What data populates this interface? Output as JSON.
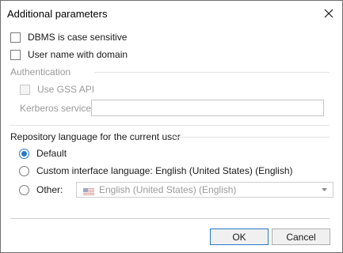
{
  "dialog": {
    "title": "Additional parameters",
    "close_icon": "close-icon"
  },
  "options": {
    "dbms_case_sensitive": {
      "label": "DBMS is case sensitive",
      "checked": false
    },
    "user_name_with_domain": {
      "label": "User name with domain",
      "checked": false
    }
  },
  "authentication": {
    "title": "Authentication",
    "use_gss_api": {
      "label": "Use GSS API",
      "checked": false,
      "enabled": false
    },
    "kerberos_service": {
      "label": "Kerberos service:",
      "value": ""
    }
  },
  "repository_language": {
    "title": "Repository language for the current user",
    "radio_default": {
      "label": "Default",
      "selected": true
    },
    "radio_custom": {
      "label": "Custom interface language: English (United States) (English)",
      "selected": false
    },
    "radio_other": {
      "label": "Other:",
      "selected": false
    },
    "language_select": {
      "value": "English (United States) (English)",
      "icon": "us-flag-icon",
      "enabled": false
    }
  },
  "buttons": {
    "ok": "OK",
    "cancel": "Cancel"
  },
  "colors": {
    "accent": "#2a78c9",
    "disabled_text": "#9a9a9a"
  }
}
